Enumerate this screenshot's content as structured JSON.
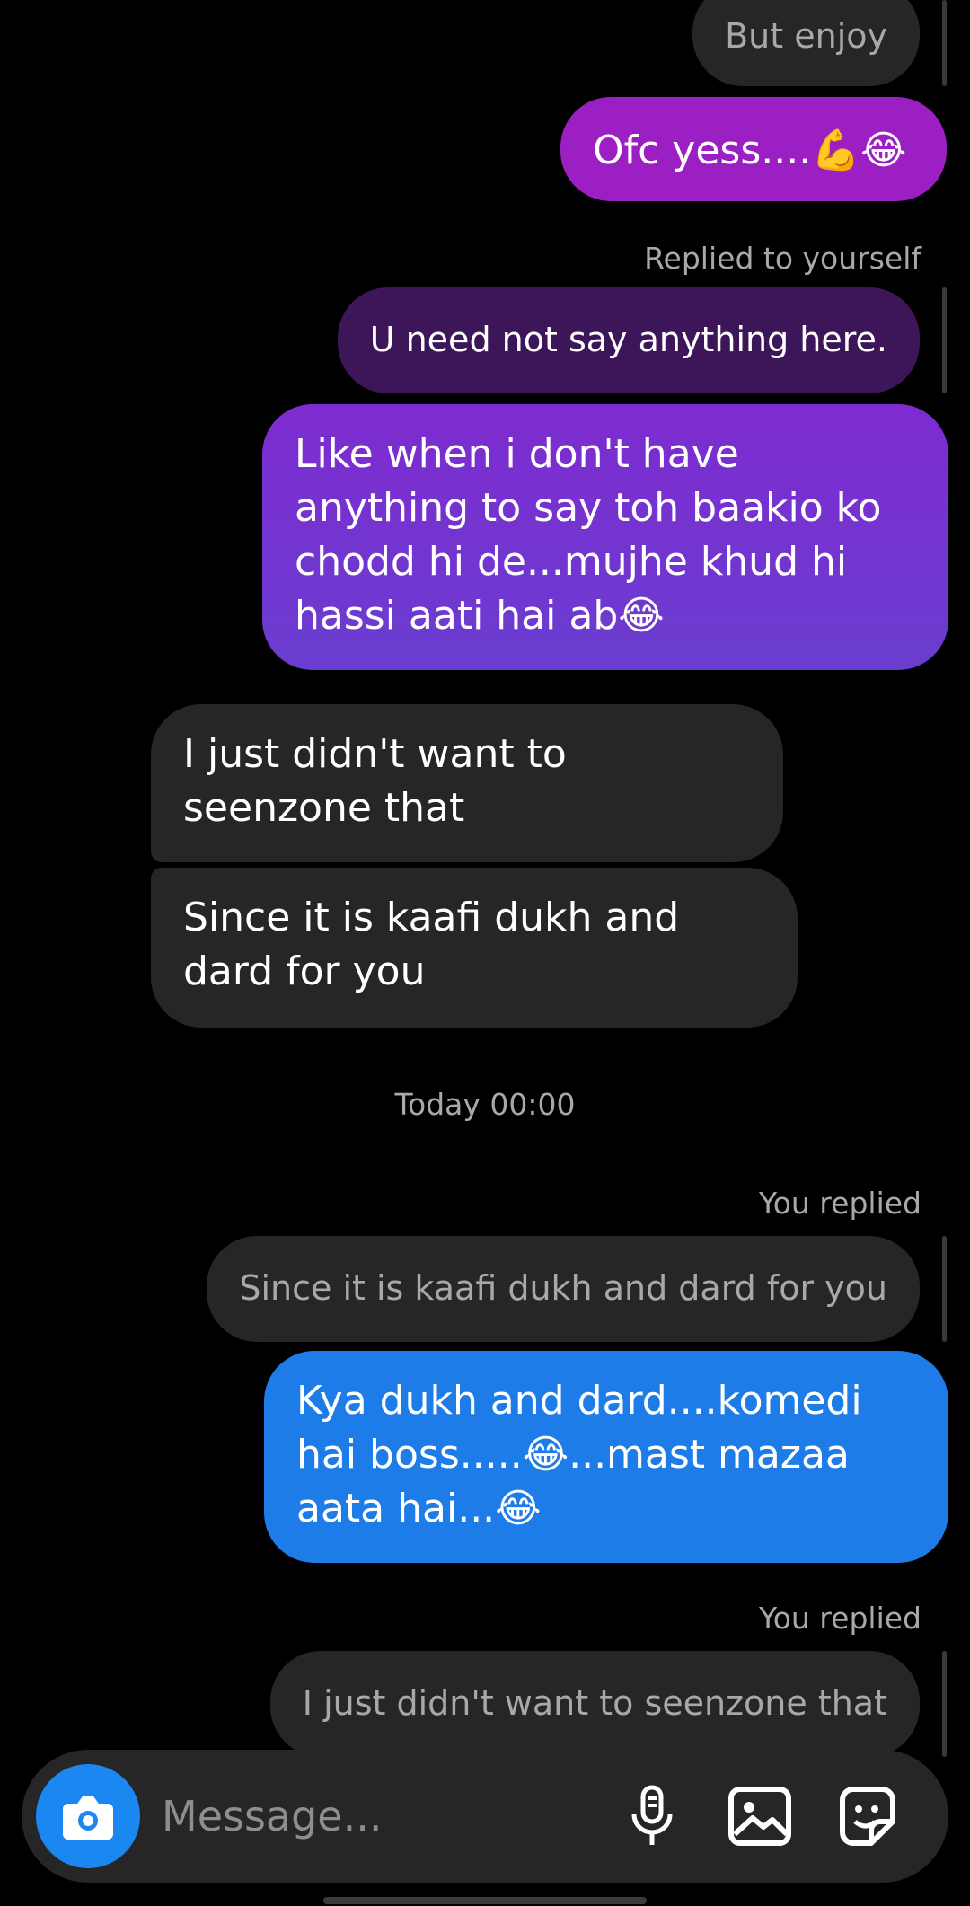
{
  "messages": [
    {
      "type": "quote",
      "text": "But enjoy"
    },
    {
      "type": "outgoing",
      "text": "Ofc yess....💪😂",
      "color": "#9b1fc2"
    },
    {
      "type": "reply_label",
      "text": "Replied to yourself"
    },
    {
      "type": "quote",
      "text": "U need not say anything here.",
      "color": "#3d165a"
    },
    {
      "type": "outgoing",
      "text": "Like when i don't have anything to say toh baakio ko chodd hi de...mujhe khud hi hassi aati hai ab😂",
      "color": "#7b2fd0"
    },
    {
      "type": "incoming",
      "text": "I just didn't want to seenzone that"
    },
    {
      "type": "incoming",
      "text": "Since it is kaafi dukh and dard for you"
    },
    {
      "type": "timestamp",
      "text": "Today 00:00"
    },
    {
      "type": "reply_label",
      "text": "You replied"
    },
    {
      "type": "quote",
      "text": "Since it is kaafi dukh and dard for you"
    },
    {
      "type": "outgoing",
      "text": "Kya dukh and dard....komedi hai boss.....😂...mast mazaa aata hai...😂",
      "color": "#1e7ce8"
    },
    {
      "type": "reply_label",
      "text": "You replied"
    },
    {
      "type": "quote",
      "text": "I just didn't want to seenzone that"
    }
  ],
  "composer": {
    "placeholder": "Message...",
    "icons": [
      "camera-icon",
      "microphone-icon",
      "gallery-icon",
      "sticker-icon"
    ],
    "camera_color": "#1b87f0"
  }
}
